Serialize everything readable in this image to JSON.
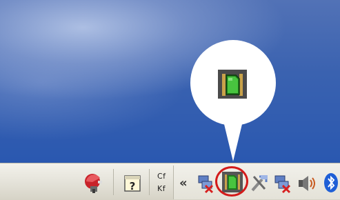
{
  "taskbar": {
    "lang_indicator": {
      "top": "Cf",
      "bottom": "Kf"
    },
    "show_hidden_label": "«"
  },
  "icons": [
    "safely-remove-hardware-icon",
    "help-icon",
    "show-hidden-icons-chevron",
    "network-disconnected-icon",
    "sd-card-icon",
    "tools-icon",
    "network-disconnected-2-icon",
    "volume-icon",
    "bluetooth-icon"
  ],
  "colors": {
    "highlight_ring": "#d31b1b",
    "sd_card_green": "#3aa836",
    "desktop_blue": "#3a62b0",
    "taskbar_bg": "#e6e4da"
  }
}
